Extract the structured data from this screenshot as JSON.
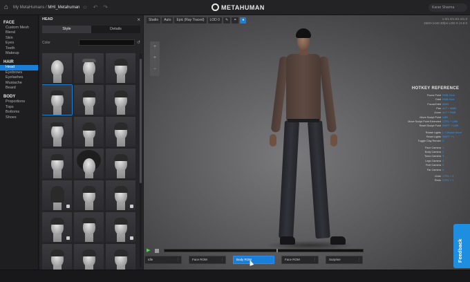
{
  "topbar": {
    "crumb_parent": "My MetaHumans",
    "crumb_sep": " / ",
    "crumb_current": "MHI_Metahuman",
    "brand": "METAHUMAN",
    "user": "Karan Sharma"
  },
  "leftnav": {
    "face_title": "FACE",
    "face_items": [
      "Custom Mesh",
      "Blend",
      "Skin",
      "Eyes",
      "Teeth",
      "Makeup"
    ],
    "hair_title": "HAIR",
    "hair_items": [
      "Head",
      "Eyebrows",
      "Eyelashes",
      "Mustache",
      "Beard"
    ],
    "hair_active": "Head",
    "body_title": "BODY",
    "body_items": [
      "Proportions",
      "Tops",
      "Bottoms",
      "Shoes"
    ]
  },
  "headpanel": {
    "title": "HEAD",
    "close": "×",
    "tab_style": "Style",
    "tab_details": "Details",
    "color_label": "Color",
    "reset_icon": "reset-icon"
  },
  "viewport": {
    "toolbar": [
      "Studio",
      "Auto",
      "Epic (Ray Traced)",
      "LOD 0"
    ],
    "info_lines": [
      "1.0/1.0/1.0/1.0/1.0",
      "2560×1440 30fps LOD 0 | 0.0.0"
    ],
    "sidetools": [
      "+",
      "+",
      "−"
    ]
  },
  "hotkey": {
    "title": "HOTKEY REFERENCE",
    "rows": [
      {
        "label": "Focus Point",
        "key": "RMB Click"
      },
      {
        "label": "Orbit",
        "key": "RMB Hold"
      },
      {
        "label": "Focus/Orbit",
        "key": "MMB"
      },
      {
        "label": "Pan",
        "key": "ALT + MMB"
      },
      {
        "label": "Zoom",
        "key": "ALT + RMB"
      },
      {
        "label": "Move Sculpt Point",
        "key": "LMB"
      },
      {
        "label": "Move Sculpt Point Extended",
        "key": "CTRL + LMB"
      },
      {
        "label": "Reset Sculpt Point",
        "key": "SHIFT + LMB"
      },
      {
        "label": "",
        "key": ""
      },
      {
        "label": "Rotate Lights",
        "key": "L + Mouse Move"
      },
      {
        "label": "Reset Lights",
        "key": "SHIFT + L"
      },
      {
        "label": "Toggle Clay Render",
        "key": "C"
      },
      {
        "label": "",
        "key": ""
      },
      {
        "label": "Face Camera",
        "key": "1"
      },
      {
        "label": "Body Camera",
        "key": "2"
      },
      {
        "label": "Torso Camera",
        "key": "3"
      },
      {
        "label": "Legs Camera",
        "key": "4"
      },
      {
        "label": "Feet Camera",
        "key": "5"
      },
      {
        "label": "Far Camera",
        "key": "6"
      },
      {
        "label": "",
        "key": ""
      },
      {
        "label": "Undo",
        "key": "CTRL + Z"
      },
      {
        "label": "Redo",
        "key": "CTRL + Y"
      }
    ]
  },
  "controls": {
    "poses": [
      {
        "label": "Idle",
        "active": false
      },
      {
        "label": "Face ROM",
        "active": false
      },
      {
        "label": "Body ROM",
        "active": true
      },
      {
        "label": "Face ROM",
        "active": false
      },
      {
        "label": "Surprise",
        "active": false
      }
    ],
    "dots": "⋮"
  },
  "feedback": "Feedback"
}
